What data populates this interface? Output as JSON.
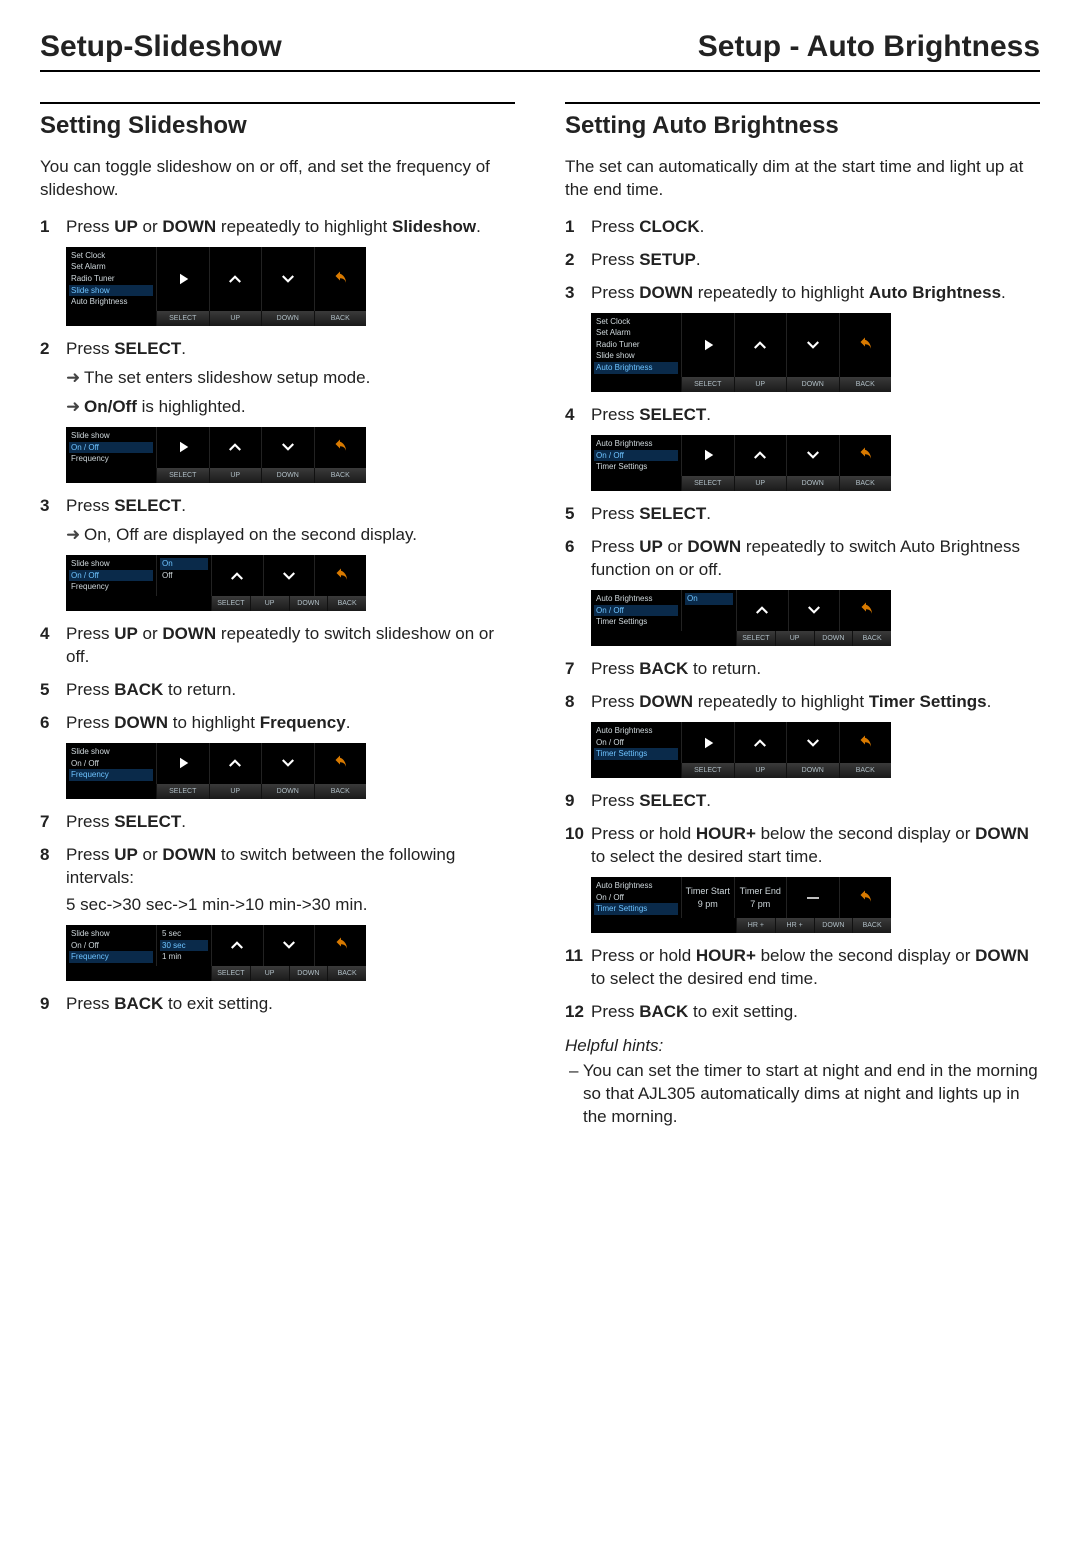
{
  "header": {
    "left": "Setup-Slideshow",
    "right": "Setup - Auto Brightness"
  },
  "buttons": [
    "SELECT",
    "UP",
    "DOWN",
    "BACK"
  ],
  "buttons_hr": [
    "HR +",
    "HR +",
    "DOWN",
    "BACK"
  ],
  "left": {
    "heading": "Setting Slideshow",
    "intro": "You can toggle slideshow on or off, and set the frequency of slideshow.",
    "s1": {
      "pre": "Press ",
      "b1": "UP",
      "mid": " or ",
      "b2": "DOWN",
      "post": " repeatedly to highlight ",
      "b3": "Slideshow",
      "end": "."
    },
    "dev1_menu": [
      "Set Clock",
      "Set Alarm",
      "Radio Tuner",
      "Slide show",
      "Auto Brightness"
    ],
    "dev1_hl": 3,
    "s2": {
      "pre": "Press ",
      "b1": "SELECT",
      "end": ".",
      "sub1": "The set enters slideshow setup mode.",
      "sub2_b": "On/Off",
      "sub2_post": " is highlighted."
    },
    "dev2_menu": [
      "Slide show",
      "On / Off",
      "Frequency"
    ],
    "dev2_hl": 1,
    "s3": {
      "pre": "Press ",
      "b1": "SELECT",
      "end": ".",
      "sub1": "On, Off are displayed on the second display."
    },
    "dev3_menu": [
      "Slide show",
      "On / Off",
      "Frequency"
    ],
    "dev3_hl": 1,
    "dev3_disp": [
      "On",
      "Off"
    ],
    "dev3_disp_hl": 0,
    "s4": {
      "pre": "Press ",
      "b1": "UP",
      "mid": " or ",
      "b2": "DOWN",
      "post": " repeatedly to switch slideshow on or off."
    },
    "s5": {
      "pre": "Press ",
      "b1": "BACK",
      "post": " to return."
    },
    "s6": {
      "pre": "Press ",
      "b1": "DOWN",
      "mid": " to highlight ",
      "b2": "Frequency",
      "end": "."
    },
    "dev4_menu": [
      "Slide show",
      "On / Off",
      "Frequency"
    ],
    "dev4_hl": 2,
    "s7": {
      "pre": "Press ",
      "b1": "SELECT",
      "end": "."
    },
    "s8": {
      "pre": "Press ",
      "b1": "UP",
      "mid": " or ",
      "b2": "DOWN",
      "post": " to switch between the following intervals:",
      "line2": "5 sec->30 sec->1 min->10 min->30 min."
    },
    "dev5_menu": [
      "Slide show",
      "On / Off",
      "Frequency"
    ],
    "dev5_hl": 2,
    "dev5_disp": [
      "5 sec",
      "30 sec",
      "1 min"
    ],
    "dev5_disp_hl": 1,
    "s9": {
      "pre": "Press ",
      "b1": "BACK",
      "post": " to exit setting."
    }
  },
  "right": {
    "heading": "Setting Auto Brightness",
    "intro": "The set can automatically dim at the start time and light up at the end time.",
    "s1": {
      "pre": "Press ",
      "b1": "CLOCK",
      "end": "."
    },
    "s2": {
      "pre": "Press ",
      "b1": "SETUP",
      "end": "."
    },
    "s3": {
      "pre": "Press ",
      "b1": "DOWN",
      "mid": " repeatedly to highlight ",
      "b2": "Auto Brightness",
      "end": "."
    },
    "dev1_menu": [
      "Set Clock",
      "Set Alarm",
      "Radio Tuner",
      "Slide show",
      "Auto Brightness"
    ],
    "dev1_hl": 4,
    "s4": {
      "pre": "Press ",
      "b1": "SELECT",
      "end": "."
    },
    "dev2_menu": [
      "Auto Brightness",
      "On / Off",
      "Timer Settings"
    ],
    "dev2_hl": 1,
    "s5": {
      "pre": "Press ",
      "b1": "SELECT",
      "end": "."
    },
    "s6": {
      "pre": "Press ",
      "b1": "UP",
      "mid": " or ",
      "b2": "DOWN",
      "post": " repeatedly to switch Auto Brightness function on or off."
    },
    "dev3_menu": [
      "Auto Brightness",
      "On / Off",
      "Timer Settings"
    ],
    "dev3_hl": 1,
    "dev3_disp": [
      "On"
    ],
    "dev3_disp_hl": 0,
    "s7": {
      "pre": "Press ",
      "b1": "BACK",
      "post": " to return."
    },
    "s8": {
      "pre": "Press ",
      "b1": "DOWN",
      "mid": " repeatedly to highlight ",
      "b2": "Timer Settings",
      "end": "."
    },
    "dev4_menu": [
      "Auto Brightness",
      "On / Off",
      "Timer Settings"
    ],
    "dev4_hl": 2,
    "s9": {
      "pre": "Press ",
      "b1": "SELECT",
      "end": "."
    },
    "s10": {
      "pre": "Press or hold ",
      "b1": "HOUR+",
      "mid": " below the second display or ",
      "b2": "DOWN",
      "post": " to select the desired start time."
    },
    "dev5_menu": [
      "Auto Brightness",
      "On / Off",
      "Timer Settings"
    ],
    "dev5_hl": 2,
    "dev5_d1_title": "Timer Start",
    "dev5_d1_val": "9 pm",
    "dev5_d2_title": "Timer End",
    "dev5_d2_val": "7 pm",
    "s11": {
      "pre": "Press or hold ",
      "b1": "HOUR+",
      "mid": " below the second display or ",
      "b2": "DOWN",
      "post": " to select the desired end time."
    },
    "s12": {
      "pre": "Press ",
      "b1": "BACK",
      "post": " to exit setting."
    },
    "hints_title": "Helpful hints:",
    "hint1": "You can set the timer to start at night and end in the morning so that AJL305 automatically dims at night and lights up in the morning."
  }
}
